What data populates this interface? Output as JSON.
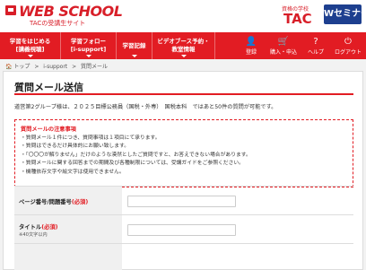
{
  "header": {
    "logo_text": "WEB SCHOOL",
    "logo_sub": "TACの受講生サイト",
    "tac_small": "資格の学校",
    "tac_big": "TAC",
    "seminar_label": "Wセミナー"
  },
  "nav": {
    "items": [
      {
        "line1": "学習をはじめる",
        "line2": "[講義視聴]"
      },
      {
        "line1": "学習フォロー",
        "line2": "[i-support]"
      },
      {
        "line1": "学習記録",
        "line2": ""
      },
      {
        "line1": "ビデオブース予約・",
        "line2": "教室情報"
      }
    ],
    "icons": [
      {
        "icon": "person-icon",
        "glyph": "👤",
        "label": "登録"
      },
      {
        "icon": "cart-icon",
        "glyph": "🛒",
        "label": "購入・申込"
      },
      {
        "icon": "help-icon",
        "glyph": "?",
        "label": "ヘルプ"
      },
      {
        "icon": "logout-icon",
        "glyph": "⏻",
        "label": "ログアウト"
      }
    ]
  },
  "breadcrumb": [
    "🏠 トップ",
    ">",
    "i-support",
    ">",
    "質問メール"
  ],
  "page": {
    "title": "質問メール送信",
    "intro": "道営第2グループ様は、２０２５目標公務員（国税・外専）　国税本科　ではあと50件の質問が可能です。"
  },
  "notice": {
    "title": "質問メールの注意事項",
    "items": [
      "・質問メール１件につき、質問事項は１項目にて承ります。",
      "・質問はできるだけ具体的にお願い致します。",
      "・「〇〇〇が解りません」だけのような漠然としたご質問ですと、お答えできない場合があります。",
      "・質問メールに関する回答までの期間及び各種制限については、受講ガイドをご参照ください。",
      "・機種依存文字や絵文字は使用できません。"
    ]
  },
  "form": {
    "page_label": "ページ番号/問題番号",
    "required": "(必須)",
    "title_label": "タイトル",
    "title_note": "※40文字以内"
  }
}
